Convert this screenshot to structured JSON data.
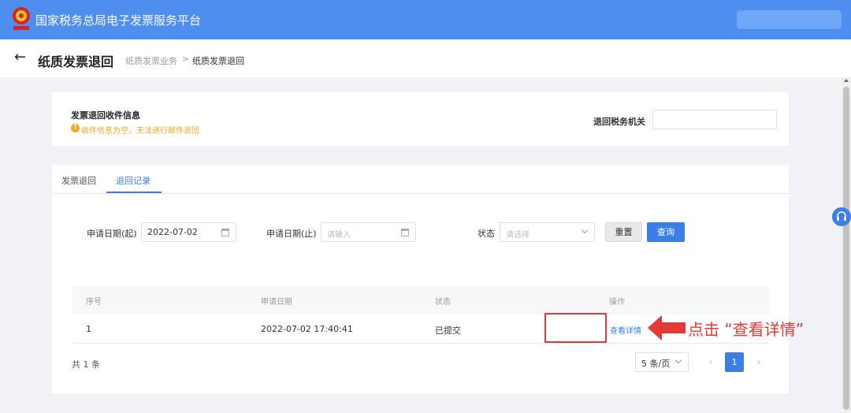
{
  "app": {
    "title": "国家税务总局电子发票服务平台"
  },
  "subheader": {
    "title": "纸质发票退回",
    "breadcrumb": [
      "纸质发票业务",
      "纸质发票退回"
    ],
    "separator": ">"
  },
  "info_card": {
    "title": "发票退回收件信息",
    "warning": "收件信息为空，无法进行邮件退回",
    "tax_office_label": "退回税务机关",
    "tax_office_value": ""
  },
  "tabs": [
    {
      "label": "发票退回",
      "active": false
    },
    {
      "label": "退回记录",
      "active": true
    }
  ],
  "filters": {
    "start_label": "申请日期(起)",
    "start_value": "2022-07-02",
    "end_label": "申请日期(止)",
    "end_placeholder": "请输入",
    "status_label": "状态",
    "status_placeholder": "请选择",
    "reset_label": "重置",
    "query_label": "查询"
  },
  "table": {
    "columns": [
      "序号",
      "申请日期",
      "状态",
      "操作"
    ],
    "rows": [
      {
        "index": "1",
        "date": "2022-07-02 17:40:41",
        "status": "已提交",
        "action": "查看详情"
      }
    ]
  },
  "pagination": {
    "total": "共 1 条",
    "page_size": "5 条/页",
    "current_page": "1",
    "prev": "‹",
    "next": "›"
  },
  "annotation": {
    "text": "点击 “查看详情”",
    "color": "#e53935"
  },
  "colors": {
    "header": "#4d8eef",
    "primary": "#3a7ee8",
    "warning": "#f5a623"
  }
}
